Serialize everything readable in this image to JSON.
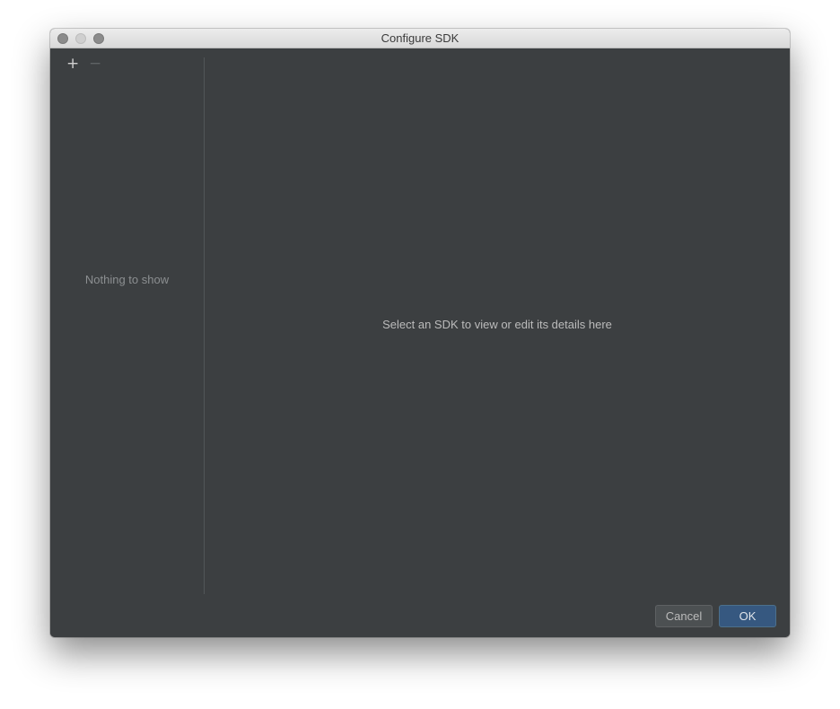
{
  "window": {
    "title": "Configure SDK"
  },
  "toolbar": {
    "add_symbol": "+",
    "remove_symbol": "−"
  },
  "sdk_list": {
    "empty_text": "Nothing to show"
  },
  "details": {
    "empty_text": "Select an SDK to view or edit its details here"
  },
  "buttons": {
    "cancel_label": "Cancel",
    "ok_label": "OK"
  },
  "colors": {
    "panel_bg": "#3c3f41",
    "ok_button": "#365880"
  }
}
